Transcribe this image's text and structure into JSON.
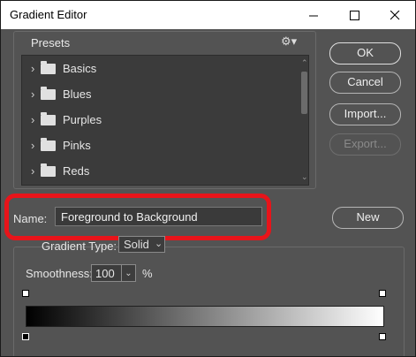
{
  "window": {
    "title": "Gradient Editor",
    "controls": {
      "minimize": "minimize-icon",
      "maximize": "maximize-icon",
      "close": "close-icon"
    }
  },
  "presets": {
    "label": "Presets",
    "menu_icon": "gear-icon",
    "items": [
      {
        "label": "Basics"
      },
      {
        "label": "Blues"
      },
      {
        "label": "Purples"
      },
      {
        "label": "Pinks"
      },
      {
        "label": "Reds"
      }
    ]
  },
  "buttons": {
    "ok": "OK",
    "cancel": "Cancel",
    "import": "Import...",
    "export": "Export...",
    "new": "New"
  },
  "name": {
    "label": "Name:",
    "value": "Foreground to Background"
  },
  "gradient": {
    "type_label": "Gradient Type:",
    "type_value": "Solid",
    "smoothness_label": "Smoothness:",
    "smoothness_value": "100",
    "smoothness_unit": "%",
    "start_color": "#000000",
    "end_color": "#ffffff"
  },
  "colors": {
    "highlight": "#e8141a",
    "panel": "#535353",
    "list_bg": "#3b3b3b"
  }
}
